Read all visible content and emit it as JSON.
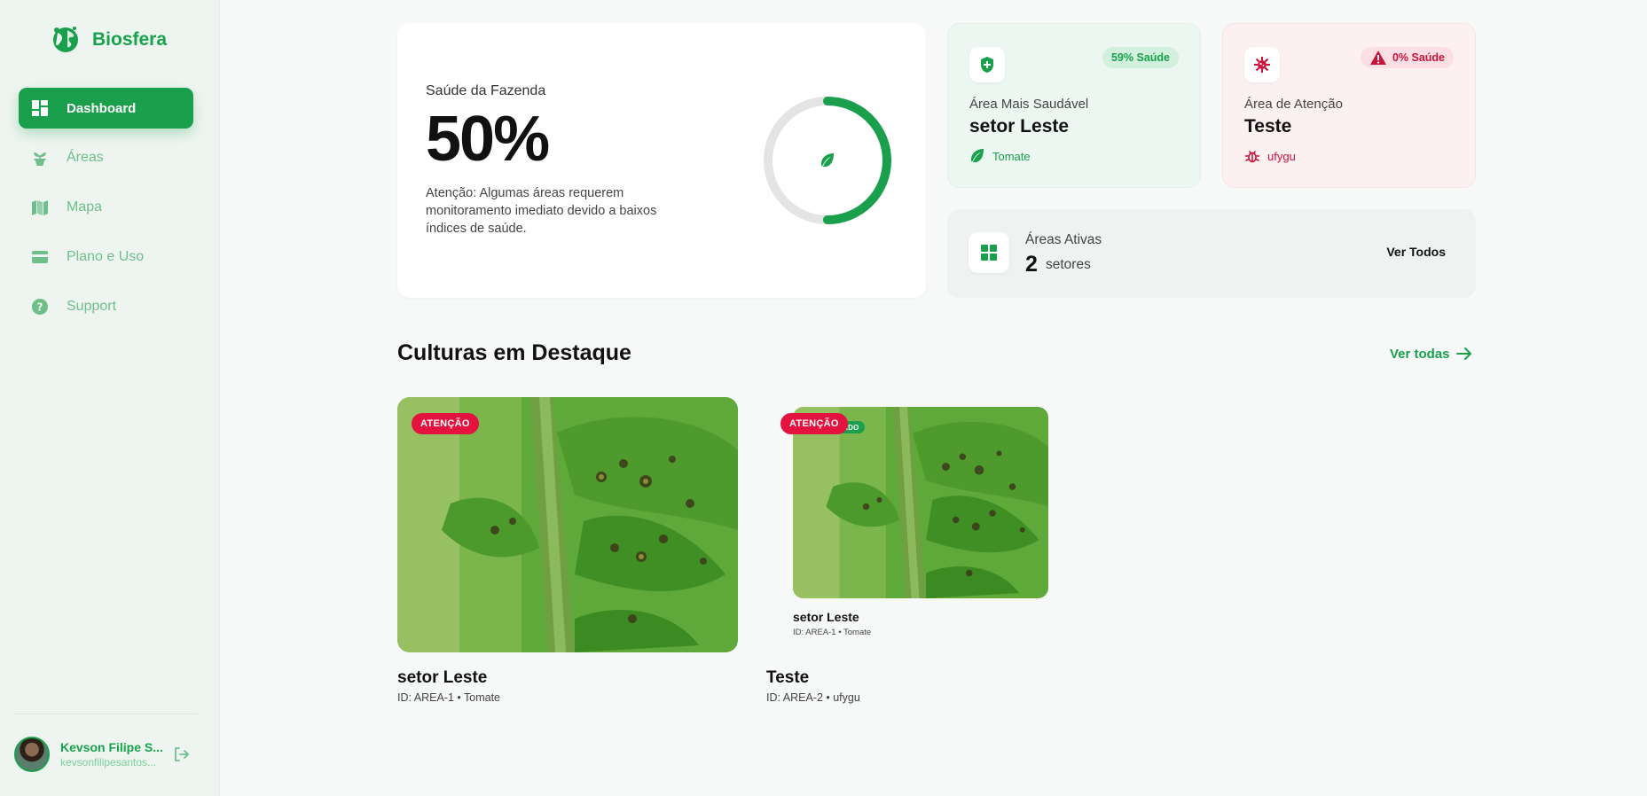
{
  "app": {
    "name": "Biosfera"
  },
  "sidebar": {
    "items": [
      {
        "label": "Dashboard",
        "icon": "dashboard-icon",
        "active": true
      },
      {
        "label": "Áreas",
        "icon": "plant-pot-icon",
        "active": false
      },
      {
        "label": "Mapa",
        "icon": "map-icon",
        "active": false
      },
      {
        "label": "Plano e Uso",
        "icon": "card-icon",
        "active": false
      },
      {
        "label": "Support",
        "icon": "help-icon",
        "active": false
      }
    ],
    "user": {
      "name": "Kevson Filipe S...",
      "email": "kevsonfilipesantos..."
    }
  },
  "health": {
    "title": "Saúde da Fazenda",
    "value": "50%",
    "fraction": 0.5,
    "message": "Atenção: Algumas áreas requerem monitoramento imediato devido a baixos índices de saúde."
  },
  "healthy_area": {
    "badge": "59% Saúde",
    "label": "Área Mais Saudável",
    "name": "setor Leste",
    "crop": "Tomate"
  },
  "attention_area": {
    "badge": "0% Saúde",
    "label": "Área de Atenção",
    "name": "Teste",
    "crop": "ufygu"
  },
  "active_areas": {
    "label": "Áreas Ativas",
    "count": "2",
    "unit": "setores",
    "button": "Ver Todos"
  },
  "featured": {
    "title": "Culturas em Destaque",
    "link": "Ver todas",
    "cards": [
      {
        "badge": "ATENÇÃO",
        "name": "setor Leste",
        "meta": "ID: AREA-1 • Tomate"
      },
      {
        "badge": "ATENÇÃO",
        "underlay_badge": "ADO",
        "underlay_name": "setor Leste",
        "underlay_meta": "ID: AREA-1 • Tomate",
        "name": "Teste",
        "meta": "ID: AREA-2 • ufygu"
      }
    ]
  },
  "colors": {
    "primary": "#1a9f4c",
    "danger": "#e3123e",
    "ring_track": "#e4e4e4"
  }
}
